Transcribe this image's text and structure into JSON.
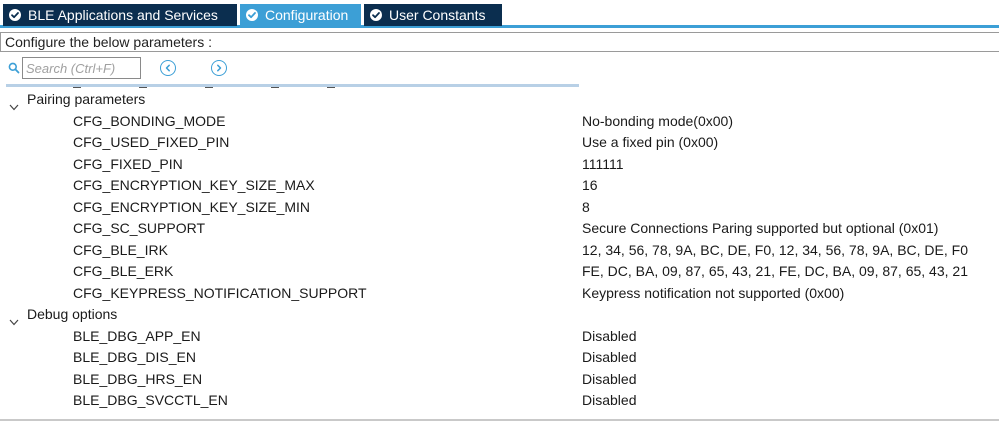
{
  "tabs": [
    {
      "label": "BLE Applications and Services",
      "state": "inactive"
    },
    {
      "label": "Configuration",
      "state": "active"
    },
    {
      "label": "User Constants",
      "state": "inactive"
    }
  ],
  "configure_label": "Configure the below parameters :",
  "search": {
    "placeholder": "Search (Ctrl+F)",
    "value": ""
  },
  "icons": {
    "search": "search-icon",
    "prev": "circle-arrow-left-icon",
    "next": "circle-arrow-right-icon",
    "expand": "chevron-down-icon",
    "tab_status": "check-circle-icon"
  },
  "colors": {
    "tab_dark": "#0b2e4f",
    "tab_active": "#3c9fd6",
    "accent": "#3c9fd6"
  },
  "groups": [
    {
      "label": "Pairing parameters",
      "params": [
        {
          "name": "CFG_BONDING_MODE",
          "value": "No-bonding mode(0x00)"
        },
        {
          "name": "CFG_USED_FIXED_PIN",
          "value": "Use a fixed pin (0x00)"
        },
        {
          "name": "CFG_FIXED_PIN",
          "value": "111111"
        },
        {
          "name": "CFG_ENCRYPTION_KEY_SIZE_MAX",
          "value": "16"
        },
        {
          "name": "CFG_ENCRYPTION_KEY_SIZE_MIN",
          "value": "8"
        },
        {
          "name": "CFG_SC_SUPPORT",
          "value": "Secure Connections Paring supported but optional (0x01)"
        },
        {
          "name": "CFG_BLE_IRK",
          "value": "12, 34, 56, 78, 9A, BC, DE, F0, 12, 34, 56, 78, 9A, BC, DE, F0"
        },
        {
          "name": "CFG_BLE_ERK",
          "value": "FE, DC, BA, 09, 87, 65, 43, 21, FE, DC, BA, 09, 87, 65, 43, 21"
        },
        {
          "name": "CFG_KEYPRESS_NOTIFICATION_SUPPORT",
          "value": "Keypress notification not supported (0x00)"
        }
      ]
    },
    {
      "label": "Debug options",
      "params": [
        {
          "name": "BLE_DBG_APP_EN",
          "value": "Disabled"
        },
        {
          "name": "BLE_DBG_DIS_EN",
          "value": "Disabled"
        },
        {
          "name": "BLE_DBG_HRS_EN",
          "value": "Disabled"
        },
        {
          "name": "BLE_DBG_SVCCTL_EN",
          "value": "Disabled"
        }
      ]
    }
  ]
}
